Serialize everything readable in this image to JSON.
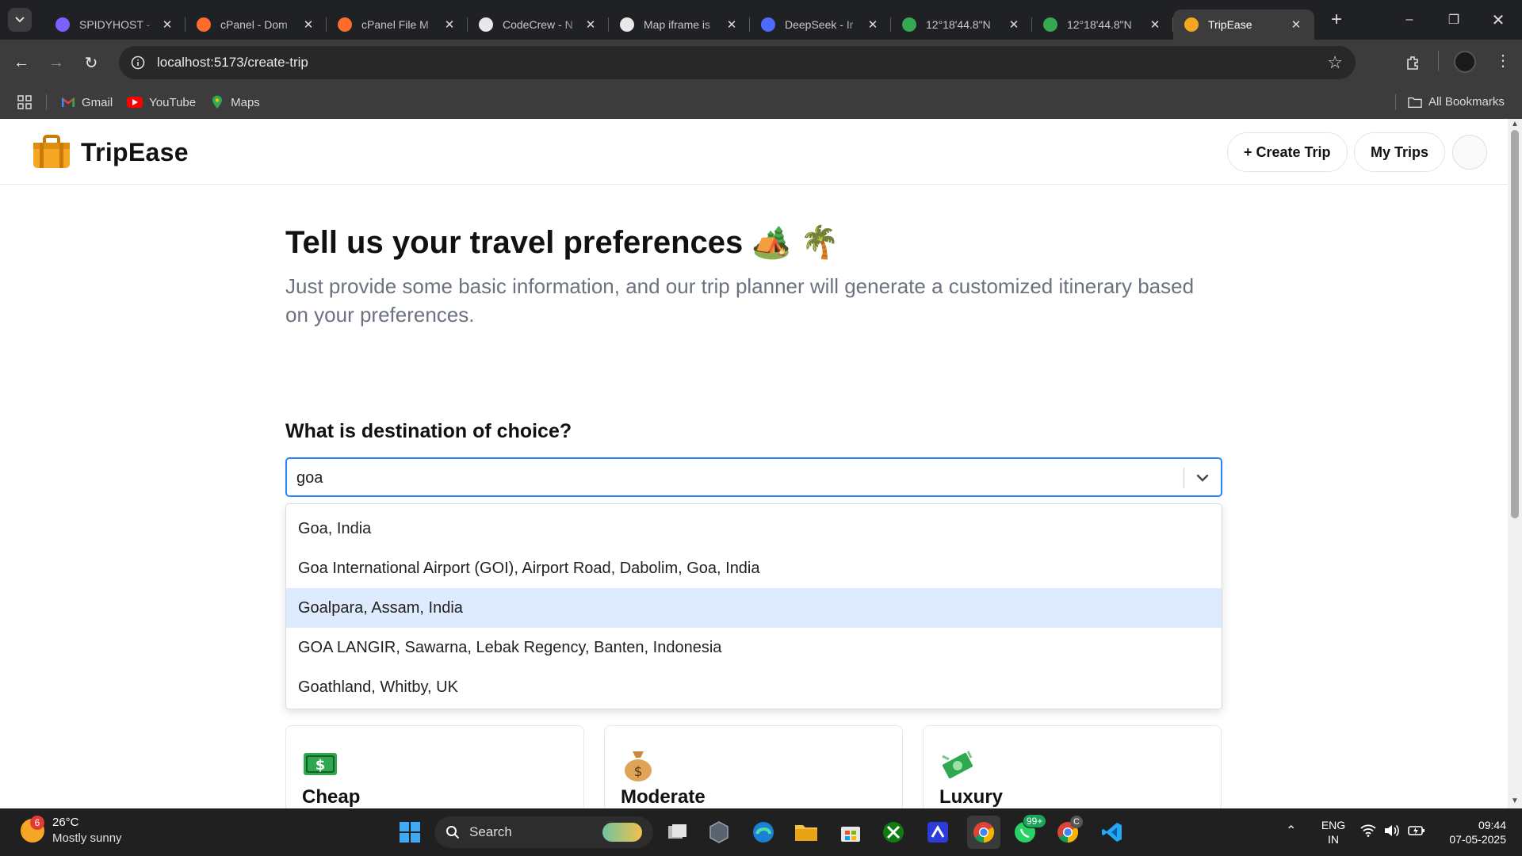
{
  "browser": {
    "tabs": [
      {
        "title": "SPIDYHOST -",
        "icon": "spidyhost-icon",
        "color": "#7b61ff"
      },
      {
        "title": "cPanel - Dom",
        "icon": "cpanel-icon",
        "color": "#ff6c2c"
      },
      {
        "title": "cPanel File M",
        "icon": "cpanel-icon",
        "color": "#ff6c2c"
      },
      {
        "title": "CodeCrew - N",
        "icon": "github-icon",
        "color": "#e8e8e8"
      },
      {
        "title": "Map iframe is",
        "icon": "openai-icon",
        "color": "#e8e8e8"
      },
      {
        "title": "DeepSeek - Ir",
        "icon": "deepseek-icon",
        "color": "#4d6bfe"
      },
      {
        "title": "12°18'44.8\"N",
        "icon": "maps-pin-icon",
        "color": "#34a853"
      },
      {
        "title": "12°18'44.8\"N",
        "icon": "maps-pin-icon",
        "color": "#34a853"
      },
      {
        "title": "TripEase",
        "icon": "tripease-icon",
        "color": "#f5a623",
        "active": true
      }
    ],
    "url": "localhost:5173/create-trip",
    "bookmarks": [
      {
        "label": "Gmail",
        "icon": "gmail-icon"
      },
      {
        "label": "YouTube",
        "icon": "youtube-icon"
      },
      {
        "label": "Maps",
        "icon": "maps-icon"
      }
    ],
    "all_bookmarks": "All Bookmarks"
  },
  "app": {
    "brand": "TripEase",
    "create_trip": "+ Create Trip",
    "my_trips": "My Trips"
  },
  "page": {
    "title": "Tell us your travel preferences 🏕️ 🌴",
    "subtitle": "Just provide some basic information, and our trip planner will generate a customized itinerary based on your preferences.",
    "destination_question": "What is destination of choice?",
    "destination_value": "goa",
    "suggestions": [
      {
        "label": "Goa, India",
        "highlighted": false
      },
      {
        "label": "Goa International Airport (GOI), Airport Road, Dabolim, Goa, India",
        "highlighted": false
      },
      {
        "label": "Goalpara, Assam, India",
        "highlighted": true
      },
      {
        "label": "GOA LANGIR, Sawarna, Lebak Regency, Banten, Indonesia",
        "highlighted": false
      },
      {
        "label": "Goathland, Whitby, UK",
        "highlighted": false
      }
    ],
    "budget_options": [
      {
        "title": "Cheap",
        "icon": "dollar-bill-icon"
      },
      {
        "title": "Moderate",
        "icon": "money-bag-icon"
      },
      {
        "title": "Luxury",
        "icon": "flying-money-icon"
      }
    ]
  },
  "taskbar": {
    "weather_temp": "26°C",
    "weather_desc": "Mostly sunny",
    "weather_badge": "6",
    "search_label": "Search",
    "whatsapp_badge": "99+",
    "chrome_profile_badge": "C",
    "lang_top": "ENG",
    "lang_bottom": "IN",
    "time": "09:44",
    "date": "07-05-2025"
  }
}
